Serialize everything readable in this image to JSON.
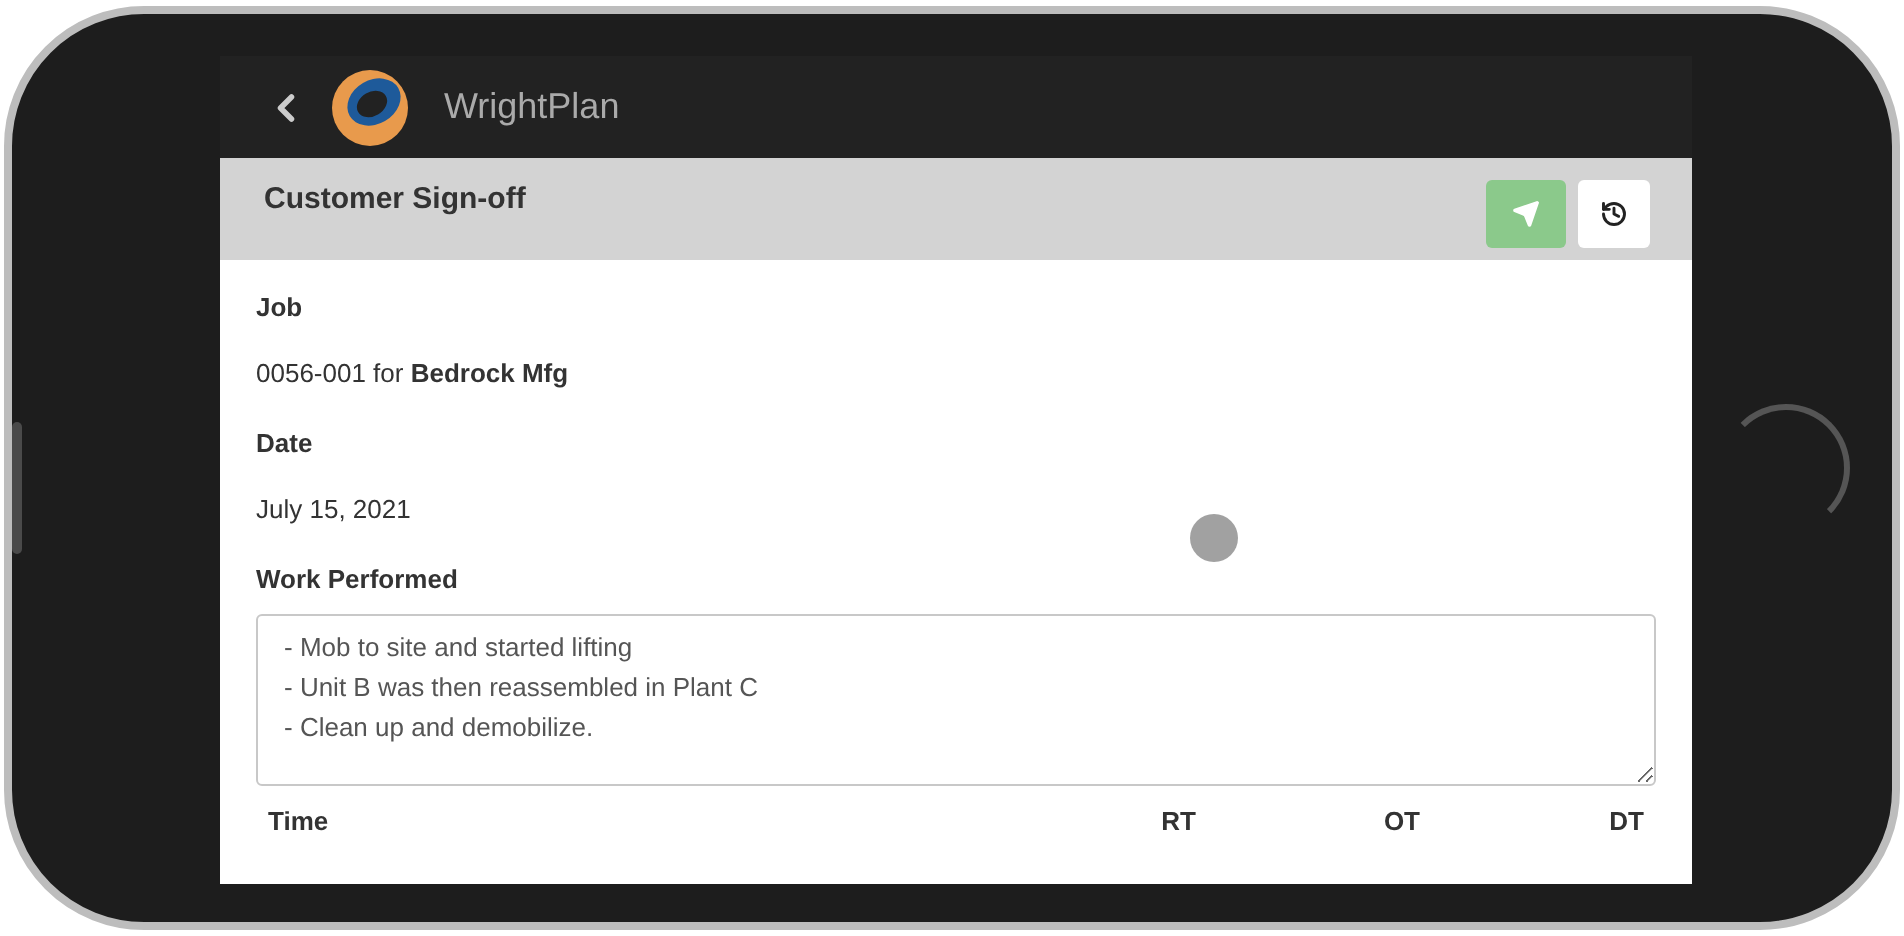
{
  "app_bar": {
    "title": "WrightPlan"
  },
  "page_header": {
    "title": "Customer Sign-off"
  },
  "fields": [
    {
      "kind": "text",
      "label": "Job",
      "value": "0056-001 for **Bedrock Mfg**"
    },
    {
      "kind": "text",
      "label": "Date",
      "value": "July 15, 2021"
    },
    {
      "kind": "textarea",
      "label": "Work Performed",
      "value": "- Mob to site and started lifting\n- Unit B was then reassembled in Plant C\n- Clean up and demobilize."
    }
  ],
  "time_table": {
    "columns": [
      "Time",
      "RT",
      "OT",
      "DT"
    ]
  }
}
